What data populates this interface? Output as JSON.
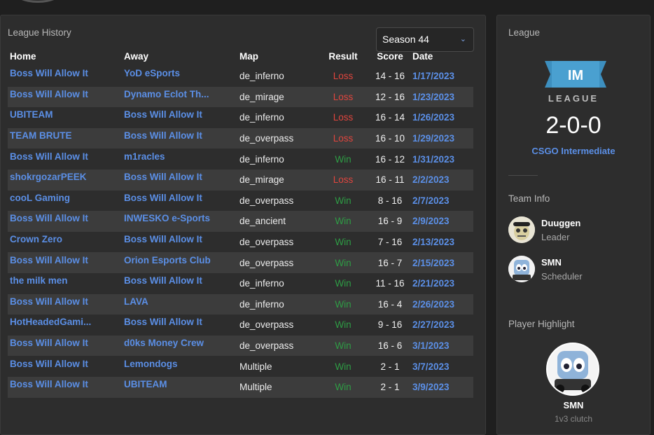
{
  "league_history": {
    "title": "League History",
    "season_select": {
      "value": "Season 44",
      "chevron_icon": "chevron-down-icon"
    },
    "columns": {
      "home": "Home",
      "away": "Away",
      "map": "Map",
      "result": "Result",
      "score": "Score",
      "date": "Date"
    },
    "matches": [
      {
        "home": "Boss Will Allow It",
        "away": "YoD eSports",
        "map": "de_inferno",
        "result": "Loss",
        "score": "14 - 16",
        "date": "1/17/2023"
      },
      {
        "home": "Boss Will Allow It",
        "away": "Dynamo Eclot Th...",
        "map": "de_mirage",
        "result": "Loss",
        "score": "12 - 16",
        "date": "1/23/2023"
      },
      {
        "home": "UBITEAM",
        "away": "Boss Will Allow It",
        "map": "de_inferno",
        "result": "Loss",
        "score": "16 - 14",
        "date": "1/26/2023"
      },
      {
        "home": "TEAM BRUTE",
        "away": "Boss Will Allow It",
        "map": "de_overpass",
        "result": "Loss",
        "score": "16 - 10",
        "date": "1/29/2023"
      },
      {
        "home": "Boss Will Allow It",
        "away": "m1racles",
        "map": "de_inferno",
        "result": "Win",
        "score": "16 - 12",
        "date": "1/31/2023"
      },
      {
        "home": "shokrgozarPEEK",
        "away": "Boss Will Allow It",
        "map": "de_mirage",
        "result": "Loss",
        "score": "16 - 11",
        "date": "2/2/2023"
      },
      {
        "home": "cooL Gaming",
        "away": "Boss Will Allow It",
        "map": "de_overpass",
        "result": "Win",
        "score": "8 - 16",
        "date": "2/7/2023"
      },
      {
        "home": "Boss Will Allow It",
        "away": "INWESKO e-Sports",
        "map": "de_ancient",
        "result": "Win",
        "score": "16 - 9",
        "date": "2/9/2023"
      },
      {
        "home": "Crown Zero",
        "away": "Boss Will Allow It",
        "map": "de_overpass",
        "result": "Win",
        "score": "7 - 16",
        "date": "2/13/2023"
      },
      {
        "home": "Boss Will Allow It",
        "away": "Orion Esports Club",
        "map": "de_overpass",
        "result": "Win",
        "score": "16 - 7",
        "date": "2/15/2023"
      },
      {
        "home": "the milk men",
        "away": "Boss Will Allow It",
        "map": "de_inferno",
        "result": "Win",
        "score": "11 - 16",
        "date": "2/21/2023"
      },
      {
        "home": "Boss Will Allow It",
        "away": "LAVA",
        "map": "de_inferno",
        "result": "Win",
        "score": "16 - 4",
        "date": "2/26/2023"
      },
      {
        "home": "HotHeadedGami...",
        "away": "Boss Will Allow It",
        "map": "de_overpass",
        "result": "Win",
        "score": "9 - 16",
        "date": "2/27/2023"
      },
      {
        "home": "Boss Will Allow It",
        "away": "d0ks Money Crew",
        "map": "de_overpass",
        "result": "Win",
        "score": "16 - 6",
        "date": "3/1/2023"
      },
      {
        "home": "Boss Will Allow It",
        "away": "Lemondogs",
        "map": "Multiple",
        "result": "Win",
        "score": "2 - 1",
        "date": "3/7/2023"
      },
      {
        "home": "Boss Will Allow It",
        "away": "UBITEAM",
        "map": "Multiple",
        "result": "Win",
        "score": "2 - 1",
        "date": "3/9/2023"
      }
    ]
  },
  "league": {
    "title": "League",
    "logo_text": "IM",
    "logo_word": "LEAGUE",
    "record": "2-0-0",
    "name": "CSGO Intermediate"
  },
  "team_info": {
    "title": "Team Info",
    "members": [
      {
        "name": "Duuggen",
        "role": "Leader"
      },
      {
        "name": "SMN",
        "role": "Scheduler"
      }
    ]
  },
  "player_highlight": {
    "title": "Player Highlight",
    "name": "SMN",
    "subtitle": "1v3 clutch"
  },
  "colors": {
    "link": "#5b8fe6",
    "loss": "#e0453e",
    "win": "#2e9d45",
    "panel": "#2d2d2d",
    "background": "#1f1f1f",
    "league_logo": "#3d8fbf"
  }
}
